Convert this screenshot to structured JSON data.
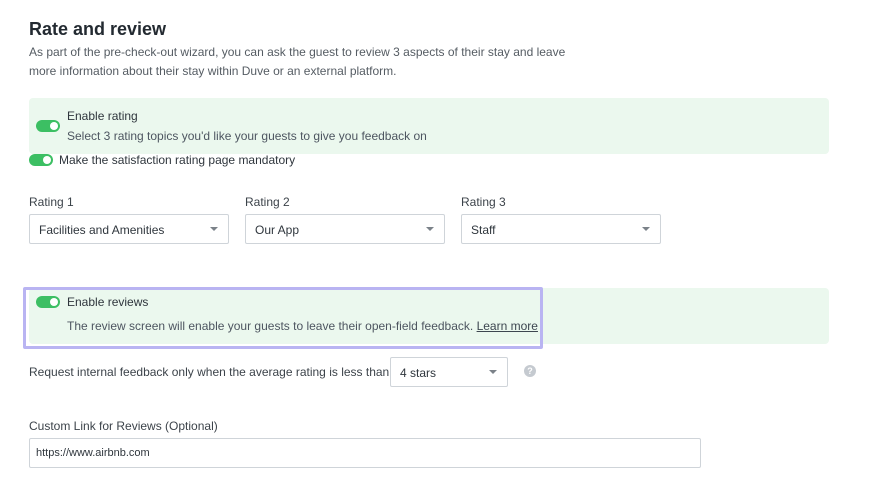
{
  "section": {
    "title": "Rate and review",
    "description": "As part of the pre-check-out wizard, you can ask the guest to review 3 aspects of their stay and leave more information about their stay within Duve or an external platform."
  },
  "rating_panel": {
    "enable_label": "Enable rating",
    "enable_sub": "Select 3 rating topics you'd like your guests to give you feedback on",
    "mandatory_label": "Make the satisfaction rating page mandatory"
  },
  "ratings": [
    {
      "label": "Rating 1",
      "value": "Facilities and Amenities"
    },
    {
      "label": "Rating 2",
      "value": "Our App"
    },
    {
      "label": "Rating 3",
      "value": "Staff"
    }
  ],
  "reviews_panel": {
    "enable_label": "Enable reviews",
    "sub": "The review screen will enable your guests to leave their open-field feedback.",
    "learn_more": "Learn more"
  },
  "internal_feedback": {
    "label": "Request internal feedback only when the average rating is less than",
    "value": "4 stars",
    "help": "?"
  },
  "custom_link": {
    "label": "Custom Link for Reviews (Optional)",
    "value": "https://www.airbnb.com"
  },
  "colors": {
    "toggle_on": "#3cbf63",
    "panel_bg": "#ebf8ee",
    "highlight": "#b9b4f2"
  }
}
